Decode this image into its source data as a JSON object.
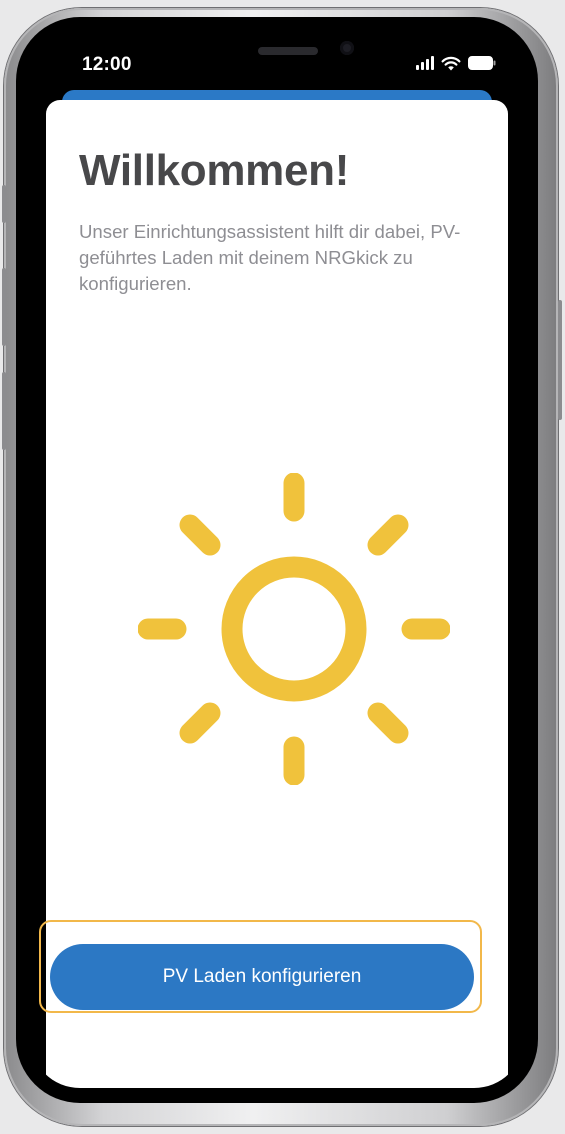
{
  "status_bar": {
    "time": "12:00"
  },
  "welcome": {
    "title": "Willkommen!",
    "description": "Unser Einrichtungsassistent hilft dir dabei, PV-geführtes Laden mit deinem NRGkick zu konfigurieren."
  },
  "illustration": {
    "icon": "sun-icon",
    "color": "#f0c23c"
  },
  "actions": {
    "primary_label": "PV Laden konfigurieren"
  },
  "colors": {
    "accent_blue": "#2c78c4",
    "highlight_outline": "#f2b84a",
    "title_text": "#48484a",
    "body_text": "#8e8e93"
  }
}
